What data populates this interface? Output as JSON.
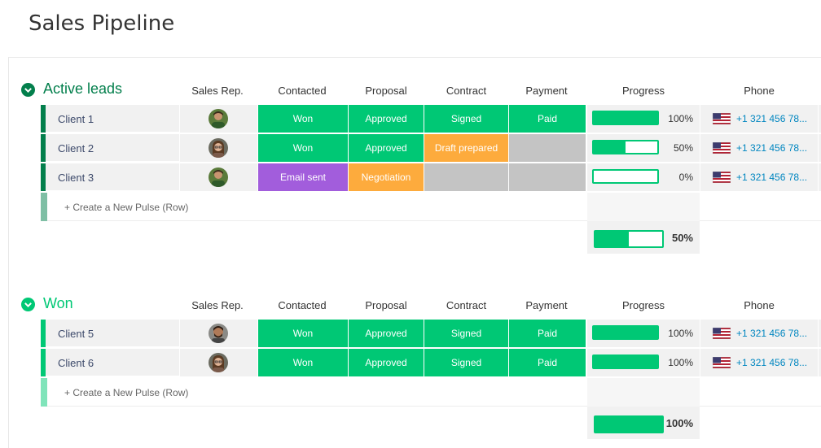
{
  "page": {
    "title": "Sales Pipeline"
  },
  "columns": {
    "sales_rep": "Sales Rep.",
    "contacted": "Contacted",
    "proposal": "Proposal",
    "contract": "Contract",
    "payment": "Payment",
    "progress": "Progress",
    "phone": "Phone"
  },
  "colors": {
    "green": "#00c875",
    "orange": "#fdab3d",
    "purple": "#a25ddc",
    "empty": "#c4c4c4",
    "group_active": "#037f4c",
    "group_won": "#00c875",
    "phone_link": "#0086c0"
  },
  "groups": [
    {
      "title": "Active leads",
      "color": "#037f4c",
      "light_color": "#7fbfa5",
      "rows": [
        {
          "name": "Client 1",
          "avatar": "avatar-man-green-shirt",
          "contacted": "Won",
          "contacted_color": "#00c875",
          "proposal": "Approved",
          "proposal_color": "#00c875",
          "contract": "Signed",
          "contract_color": "#00c875",
          "payment": "Paid",
          "payment_color": "#00c875",
          "progress": 1.0,
          "progress_label": "100%",
          "phone": "+1 321 456 78..."
        },
        {
          "name": "Client 2",
          "avatar": "avatar-woman-glasses",
          "contacted": "Won",
          "contacted_color": "#00c875",
          "proposal": "Approved",
          "proposal_color": "#00c875",
          "contract": "Draft prepared",
          "contract_color": "#fdab3d",
          "payment": "",
          "payment_color": "#c4c4c4",
          "progress": 0.5,
          "progress_label": "50%",
          "phone": "+1 321 456 78..."
        },
        {
          "name": "Client 3",
          "avatar": "avatar-man-green-shirt",
          "contacted": "Email sent",
          "contacted_color": "#a25ddc",
          "proposal": "Negotiation",
          "proposal_color": "#fdab3d",
          "contract": "",
          "contract_color": "#c4c4c4",
          "payment": "",
          "payment_color": "#c4c4c4",
          "progress": 0.0,
          "progress_label": "0%",
          "phone": "+1 321 456 78..."
        }
      ],
      "new_row_label": "+ Create a New Pulse (Row)",
      "summary": {
        "progress": 0.5,
        "label": "50%"
      }
    },
    {
      "title": "Won",
      "color": "#00c875",
      "light_color": "#80e4ba",
      "rows": [
        {
          "name": "Client 5",
          "avatar": "avatar-man-beard",
          "contacted": "Won",
          "contacted_color": "#00c875",
          "proposal": "Approved",
          "proposal_color": "#00c875",
          "contract": "Signed",
          "contract_color": "#00c875",
          "payment": "Paid",
          "payment_color": "#00c875",
          "progress": 1.0,
          "progress_label": "100%",
          "phone": "+1 321 456 78..."
        },
        {
          "name": "Client 6",
          "avatar": "avatar-woman-glasses",
          "contacted": "Won",
          "contacted_color": "#00c875",
          "proposal": "Approved",
          "proposal_color": "#00c875",
          "contract": "Signed",
          "contract_color": "#00c875",
          "payment": "Paid",
          "payment_color": "#00c875",
          "progress": 1.0,
          "progress_label": "100%",
          "phone": "+1 321 456 78..."
        }
      ],
      "new_row_label": "+ Create a New Pulse (Row)",
      "summary": {
        "progress": 1.0,
        "label": "100%"
      }
    }
  ]
}
